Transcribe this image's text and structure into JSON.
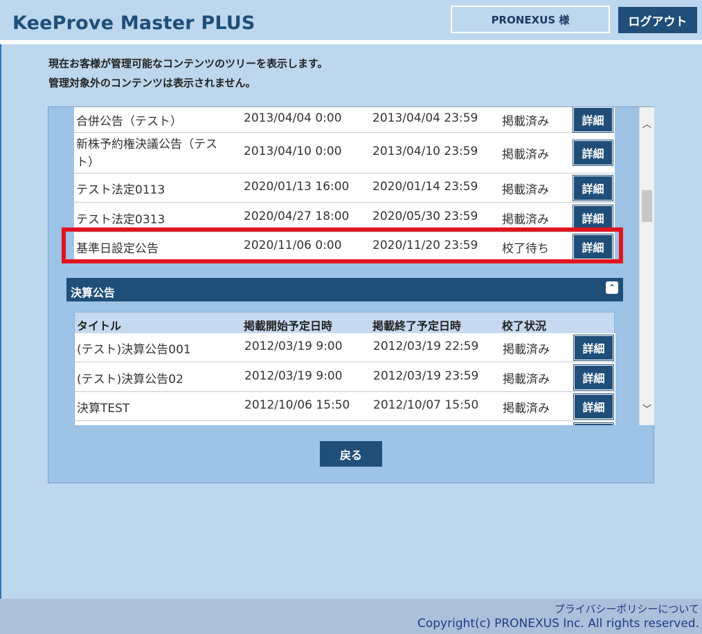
{
  "header": {
    "app_title": "KeeProve Master PLUS",
    "user_label": "PRONEXUS 様",
    "logout_label": "ログアウト"
  },
  "intro": {
    "line1": "現在お客様が管理可能なコンテンツのツリーを表示します。",
    "line2": "管理対象外のコンテンツは表示されません。"
  },
  "detail_label": "詳細",
  "upper_rows": [
    {
      "title": "合併公告（テスト）",
      "start": "2013/04/04 0:00",
      "end": "2013/04/04 23:59",
      "status": "掲載済み"
    },
    {
      "title": "新株予約権決議公告（テスト）",
      "start": "2013/04/10 0:00",
      "end": "2013/04/10 23:59",
      "status": "掲載済み"
    },
    {
      "title": "テスト法定0113",
      "start": "2020/01/13 16:00",
      "end": "2020/01/14 23:59",
      "status": "掲載済み"
    },
    {
      "title": "テスト法定0313",
      "start": "2020/04/27 18:00",
      "end": "2020/05/30 23:59",
      "status": "掲載済み"
    },
    {
      "title": "基準日設定公告",
      "start": "2020/11/06 0:00",
      "end": "2020/11/20 23:59",
      "status": "校了待ち"
    }
  ],
  "section": {
    "title": "決算公告",
    "columns": {
      "title": "タイトル",
      "start": "掲載開始予定日時",
      "end": "掲載終了予定日時",
      "status": "校了状況"
    },
    "rows": [
      {
        "title": "(テスト)決算公告001",
        "start": "2012/03/19 9:00",
        "end": "2012/03/19 22:59",
        "status": "掲載済み"
      },
      {
        "title": "(テスト)決算公告02",
        "start": "2012/03/19 9:00",
        "end": "2012/03/19 23:59",
        "status": "掲載済み"
      },
      {
        "title": "決算TEST",
        "start": "2012/10/06 15:50",
        "end": "2012/10/07 15:50",
        "status": "掲載済み"
      }
    ]
  },
  "back_label": "戻る",
  "footer": {
    "privacy": "プライバシーポリシーについて",
    "copyright": "Copyright(c) PRONEXUS Inc. All rights reserved."
  }
}
